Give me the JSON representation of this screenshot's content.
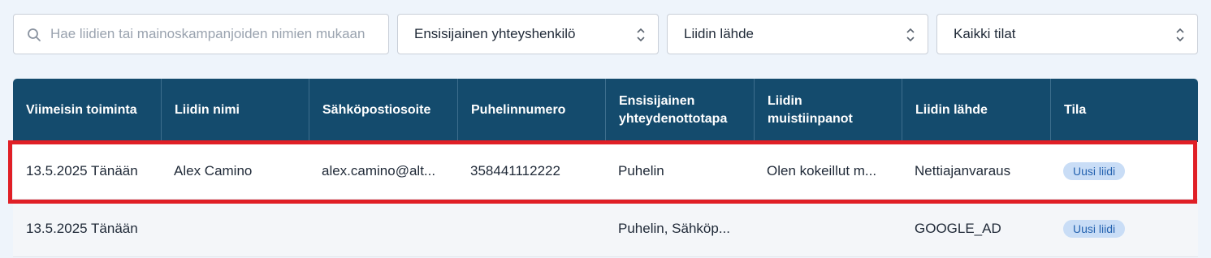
{
  "filters": {
    "search_placeholder": "Hae liidien tai mainoskampanjoiden nimien mukaan",
    "primary_contact": "Ensisijainen yhteyshenkilö",
    "lead_source": "Liidin lähde",
    "status": "Kaikki tilat"
  },
  "table": {
    "headers": [
      "Viimeisin toiminta",
      "Liidin nimi",
      "Sähköpostiosoite",
      "Puhelinnumero",
      "Ensisijainen yhteydenottotapa",
      "Liidin muistiinpanot",
      "Liidin lähde",
      "Tila"
    ],
    "rows": [
      {
        "last_activity": "13.5.2025 Tänään",
        "name": "Alex Camino",
        "email": "alex.camino@alt...",
        "phone": "358441112222",
        "contact_method": "Puhelin",
        "notes": "Olen kokeillut m...",
        "source": "Nettiajanvaraus",
        "status": "Uusi liidi"
      },
      {
        "last_activity": "13.5.2025 Tänään",
        "name": "",
        "email": "",
        "phone": "",
        "contact_method": "Puhelin, Sähköp...",
        "notes": "",
        "source": "GOOGLE_AD",
        "status": "Uusi liidi"
      }
    ]
  },
  "colors": {
    "header_bg": "#144b6d",
    "highlight": "#e01f26",
    "badge_bg": "#c9ddf6",
    "badge_text": "#2563b0"
  }
}
